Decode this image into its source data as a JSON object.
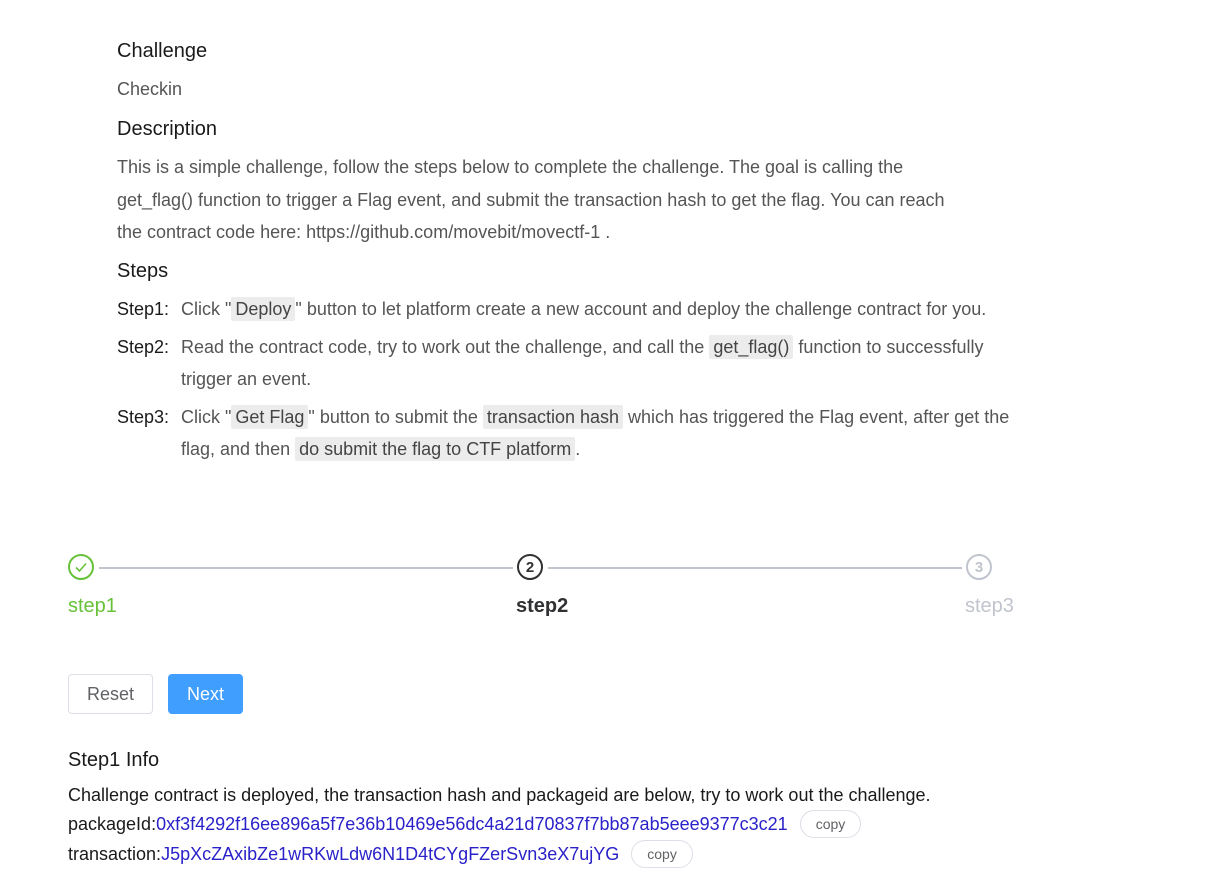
{
  "challenge": {
    "heading": "Challenge",
    "name": "Checkin"
  },
  "description": {
    "heading": "Description",
    "line1": "This is a simple challenge, follow the steps below to complete the challenge. The goal is calling the",
    "line2": "get_flag() function to trigger a Flag event, and submit the transaction hash to get the flag. You can reach",
    "line3": "the contract code here: https://github.com/movebit/movectf-1 ."
  },
  "steps": {
    "heading": "Steps",
    "step1": {
      "label": "Step1:",
      "pre": "Click \"",
      "code": "Deploy",
      "post": "\" button to let platform create a new account and deploy the challenge contract for you."
    },
    "step2": {
      "label": "Step2:",
      "pre": "Read the contract code, try to work out the challenge, and call the ",
      "code": "get_flag()",
      "post": " function to successfully trigger an event."
    },
    "step3": {
      "label": "Step3:",
      "pre": "Click \"",
      "code1": "Get Flag",
      "mid1": "\" button to submit the ",
      "code2": "transaction hash",
      "mid2": " which has triggered the Flag event, after get the flag, and then ",
      "code3": "do submit the flag to CTF platform",
      "post": "."
    }
  },
  "progress": {
    "step1": {
      "title": "step1",
      "status": "done"
    },
    "step2": {
      "title": "step2",
      "number": "2",
      "status": "active"
    },
    "step3": {
      "title": "step3",
      "number": "3",
      "status": "wait"
    },
    "colors": {
      "done": "#67c23a",
      "active": "#303133",
      "wait": "#c0c4cc"
    }
  },
  "buttons": {
    "reset": "Reset",
    "next": "Next",
    "next_color": "#409eff"
  },
  "info": {
    "heading": "Step1 Info",
    "message": "Challenge contract is deployed, the transaction hash and packageid are below, try to work out the challenge.",
    "package_label": "packageId: ",
    "package_value": "0xf3f4292f16ee896a5f7e36b10469e56dc4a21d70837f7bb87ab5eee9377c3c21",
    "transaction_label": "transaction:",
    "transaction_value": "J5pXcZAxibZe1wRKwLdw6N1D4tCYgFZerSvn3eX7ujYG",
    "copy_label": "copy"
  }
}
